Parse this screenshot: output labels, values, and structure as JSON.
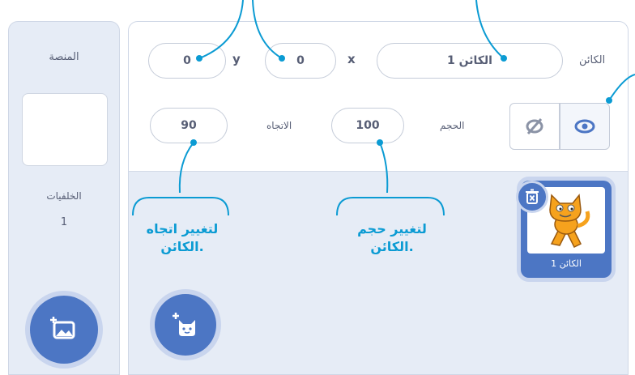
{
  "stage": {
    "title": "المنصة",
    "backdrops_label": "الخلفيات",
    "backdrops_count": "1"
  },
  "sprite_info": {
    "sprite_label": "الكائن",
    "sprite_name": "الكائن 1",
    "x_label": "x",
    "x_value": "0",
    "y_label": "y",
    "y_value": "0",
    "size_label": "الحجم",
    "size_value": "100",
    "direction_label": "الاتجاه",
    "direction_value": "90"
  },
  "sprite_list": [
    {
      "name": "الكائن 1"
    }
  ],
  "callouts": {
    "direction_line1": "لتغيير اتجاه",
    "direction_line2": "الكائن.",
    "size_line1": "لتغيير حجم",
    "size_line2": "الكائن."
  },
  "colors": {
    "accent": "#4c76c4",
    "callout": "#0b9bd3",
    "panel": "#e6ecf6"
  }
}
